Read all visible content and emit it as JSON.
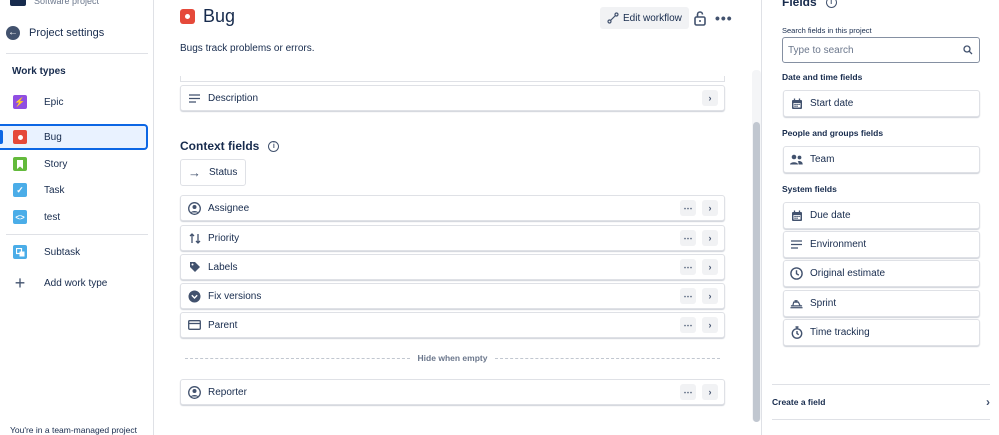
{
  "sidebar": {
    "project_type": "Software project",
    "back_label": "Project settings",
    "section_title": "Work types",
    "items": [
      {
        "label": "Epic",
        "icon": "epic-icon",
        "color": "#904ee2"
      },
      {
        "label": "Bug",
        "icon": "bug-icon",
        "color": "#e5493a",
        "selected": true
      },
      {
        "label": "Story",
        "icon": "story-icon",
        "color": "#63ba3c"
      },
      {
        "label": "Task",
        "icon": "task-icon",
        "color": "#4bade8"
      },
      {
        "label": "test",
        "icon": "code-icon",
        "color": "#4bade8"
      },
      {
        "label": "Subtask",
        "icon": "subtask-icon",
        "color": "#4bade8"
      }
    ],
    "add_label": "Add work type",
    "footer_note": "You're in a team-managed project"
  },
  "header": {
    "title": "Bug",
    "edit_workflow": "Edit workflow",
    "description": "Bugs track problems or errors."
  },
  "main": {
    "description_field": "Description",
    "context_title": "Context fields",
    "status_label": "Status",
    "context_fields": [
      {
        "label": "Assignee",
        "icon": "user-circle-icon"
      },
      {
        "label": "Priority",
        "icon": "priority-arrows-icon"
      },
      {
        "label": "Labels",
        "icon": "tag-icon"
      },
      {
        "label": "Fix versions",
        "icon": "version-icon"
      },
      {
        "label": "Parent",
        "icon": "parent-icon"
      }
    ],
    "hide_when_empty": "Hide when empty",
    "reporter_label": "Reporter"
  },
  "fields_panel": {
    "title": "Fields",
    "search_label": "Search fields in this project",
    "search_placeholder": "Type to search",
    "date_section": "Date and time fields",
    "start_date": "Start date",
    "people_section": "People and groups fields",
    "team": "Team",
    "system_section": "System fields",
    "system_fields": [
      "Due date",
      "Environment",
      "Original estimate",
      "Sprint",
      "Time tracking"
    ],
    "create_field": "Create a field"
  },
  "colors": {
    "accent": "#0c66e4",
    "selected_bg": "#e9f2ff",
    "bug": "#e5493a"
  }
}
